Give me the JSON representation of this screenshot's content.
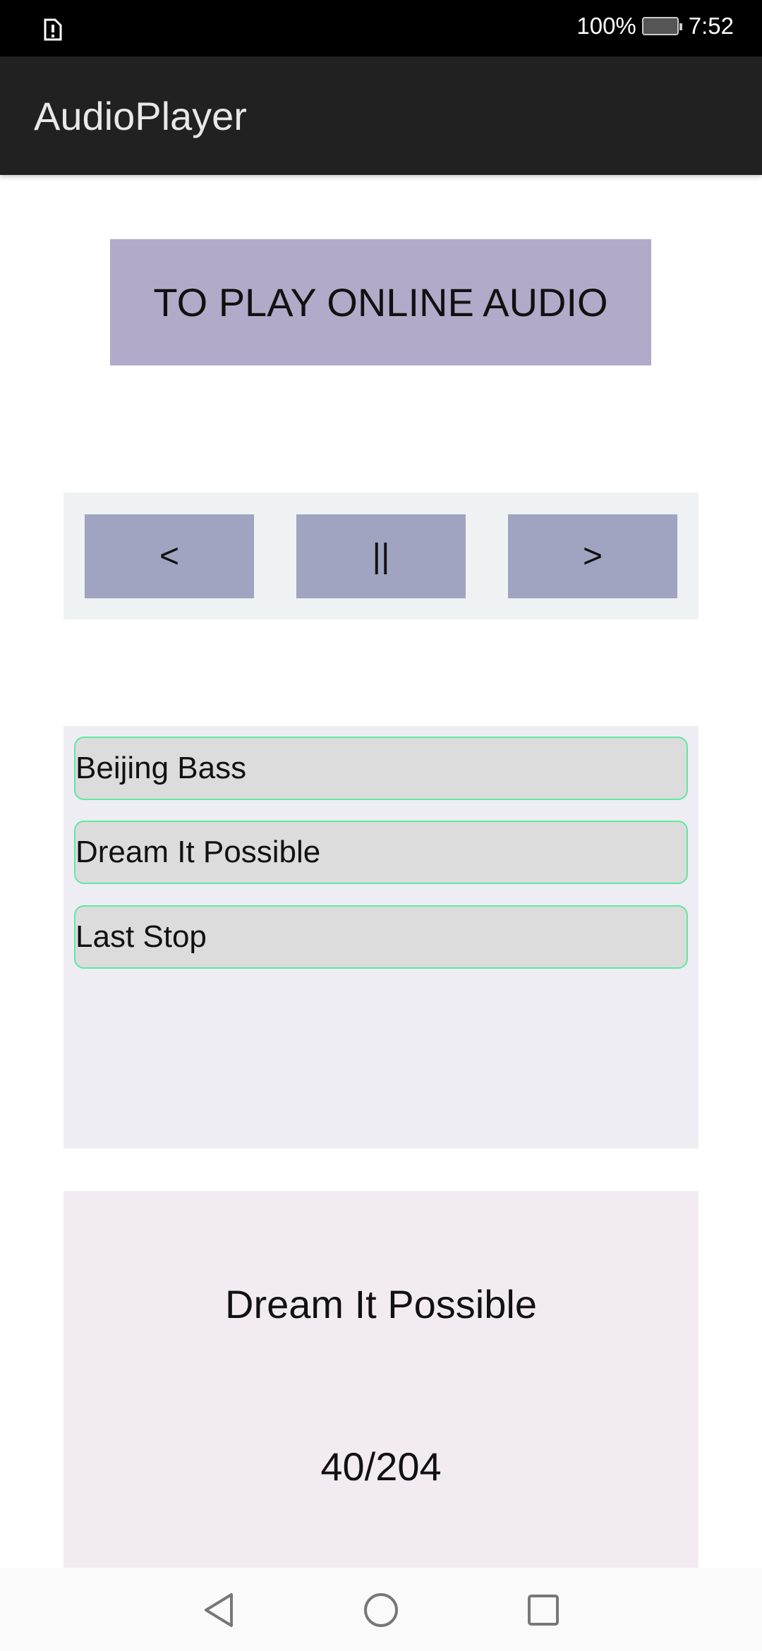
{
  "status_bar": {
    "battery": "100%",
    "time": "7:52",
    "notification_icon": "sim-alert-icon"
  },
  "toolbar": {
    "title": "AudioPlayer"
  },
  "online_button": "TO PLAY ONLINE AUDIO",
  "controls": {
    "prev": "<",
    "pause": "||",
    "next": ">"
  },
  "playlist": [
    "Beijing Bass",
    "Dream It Possible",
    "Last Stop"
  ],
  "now_playing": {
    "title": "Dream It Possible",
    "progress": "40/204"
  }
}
